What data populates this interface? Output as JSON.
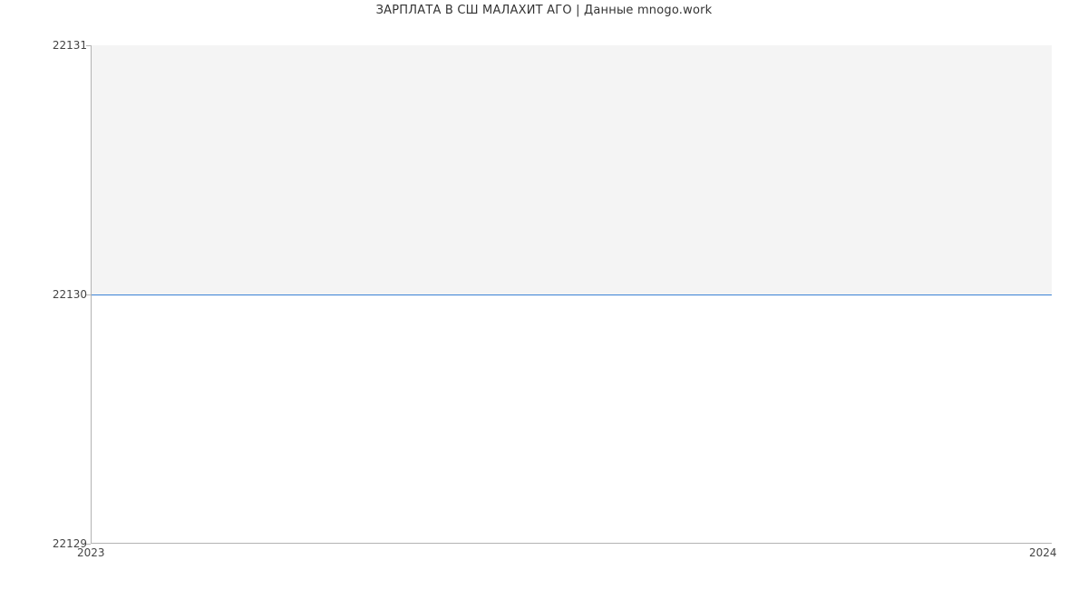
{
  "chart_data": {
    "type": "line",
    "title": "ЗАРПЛАТА В СШ МАЛАХИТ АГО | Данные mnogo.work",
    "xlabel": "",
    "ylabel": "",
    "x": [
      2023,
      2024
    ],
    "values": [
      22130,
      22130
    ],
    "xlim": [
      2023,
      2024
    ],
    "ylim": [
      22129,
      22131
    ],
    "x_tick_labels": [
      "2023",
      "2024"
    ],
    "y_tick_labels": [
      "22129",
      "22130",
      "22131"
    ],
    "line_color": "#3b82d6",
    "grid": false
  }
}
